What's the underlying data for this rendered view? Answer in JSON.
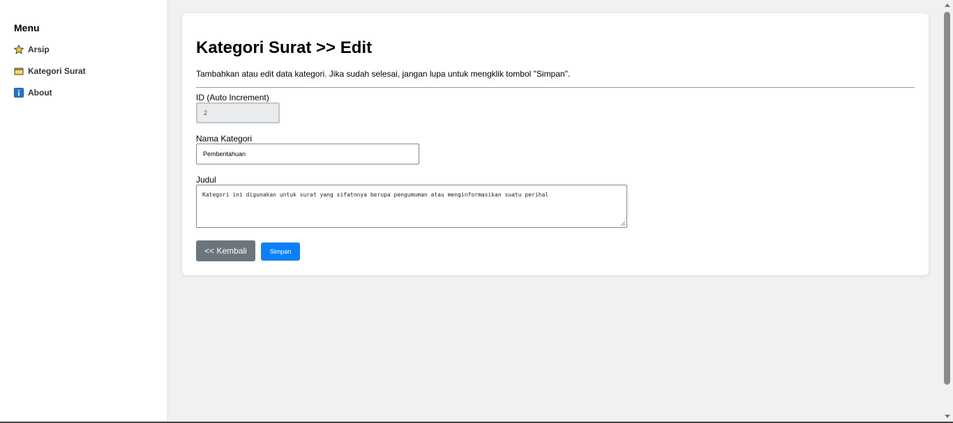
{
  "sidebar": {
    "heading": "Menu",
    "items": [
      {
        "label": "Arsip",
        "icon": "star-icon"
      },
      {
        "label": "Kategori Surat",
        "icon": "folder-icon"
      },
      {
        "label": "About",
        "icon": "info-icon"
      }
    ]
  },
  "page": {
    "title": "Kategori Surat >> Edit",
    "description": "Tambahkan atau edit data kategori. Jika sudah selesai, jangan lupa untuk mengklik tombol \"Simpan\"."
  },
  "form": {
    "id_label": "ID (Auto Increment)",
    "id_value": "2",
    "name_label": "Nama Kategori",
    "name_value": "Pemberitahuan",
    "title_label": "Judul",
    "title_value": "Kategori ini digunakan untuk surat yang sifatnnya berupa pengumuman atau menginformasikan suatu perihal"
  },
  "buttons": {
    "back_label": "<< Kembali",
    "save_label": "Simpan"
  },
  "colors": {
    "back_button": "#6c757d",
    "save_button": "#0d7ff7",
    "background": "#f1f1f4"
  }
}
